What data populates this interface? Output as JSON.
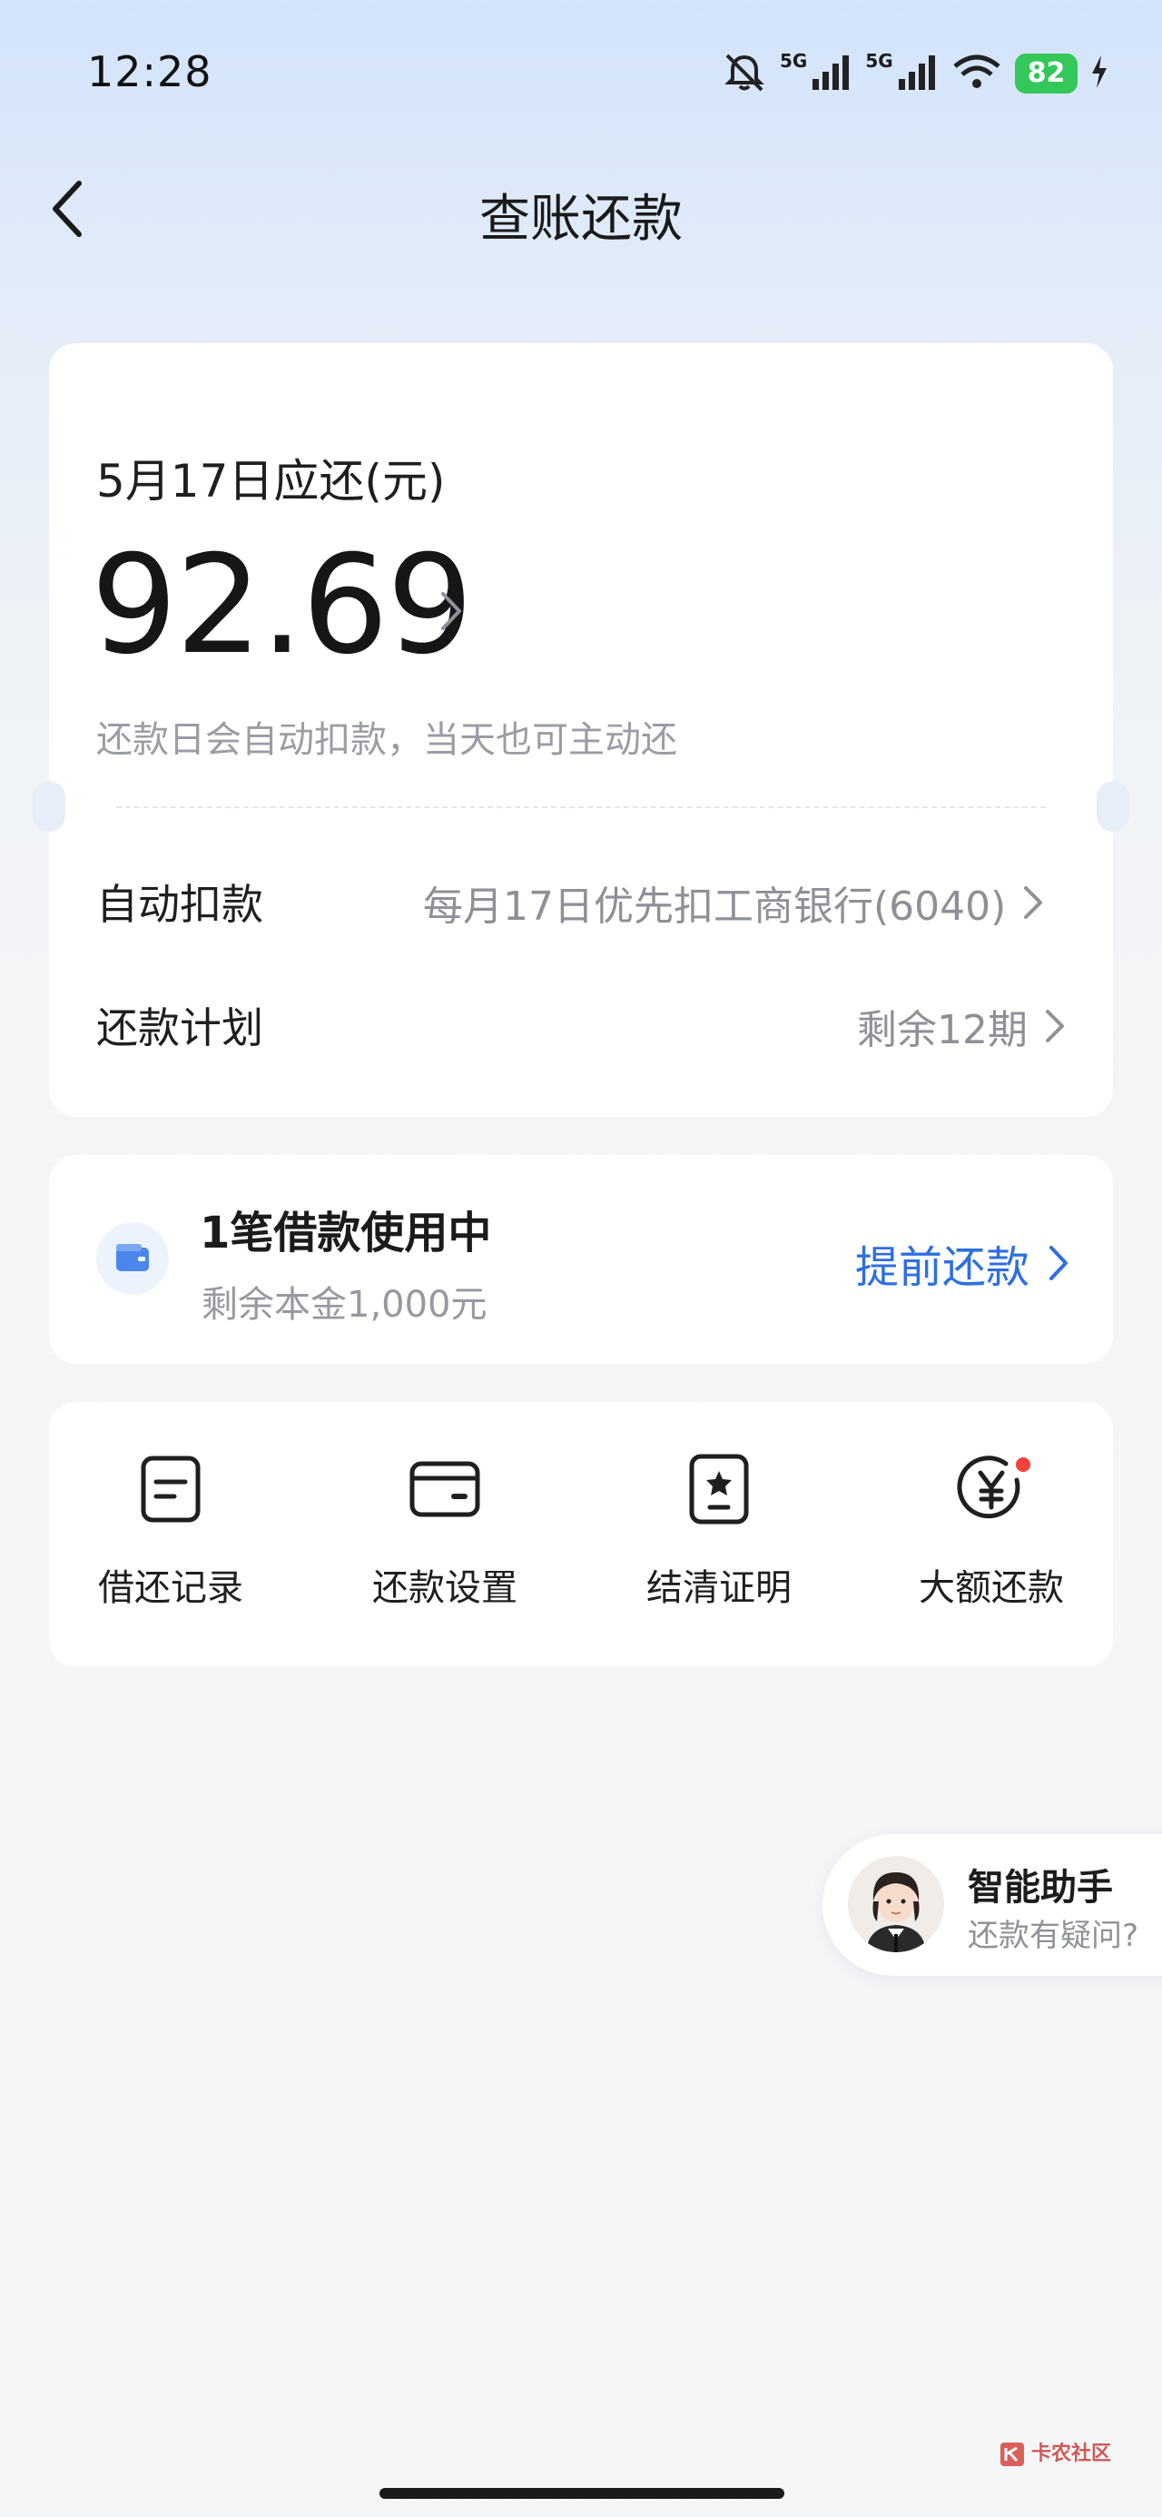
{
  "status_bar": {
    "time": "12:28",
    "network_1": "5G",
    "network_2": "5G",
    "battery": "82",
    "icons": [
      "mute-icon",
      "signal-icon",
      "signal-icon",
      "wifi-icon",
      "battery-icon",
      "charging-icon"
    ]
  },
  "header": {
    "title": "查账还款",
    "back_icon": "back-arrow-icon"
  },
  "bill": {
    "due_label": "5月17日应还(元)",
    "amount": "92.69",
    "note": "还款日会自动扣款，当天也可主动还",
    "auto_debit_label": "自动扣款",
    "auto_debit_value": "每月17日优先扣工商银行(6040)",
    "plan_label": "还款计划",
    "plan_value": "剩余12期"
  },
  "loan": {
    "title": "1笔借款使用中",
    "subtitle": "剩余本金1,000元",
    "action": "提前还款",
    "icon": "wallet-icon"
  },
  "tools": [
    {
      "label": "借还记录",
      "icon": "record-icon"
    },
    {
      "label": "还款设置",
      "icon": "card-settings-icon"
    },
    {
      "label": "结清证明",
      "icon": "certificate-icon"
    },
    {
      "label": "大额还款",
      "icon": "yuan-icon"
    }
  ],
  "assistant": {
    "title": "智能助手",
    "subtitle": "还款有疑问?"
  },
  "watermark": {
    "text": "卡农社区"
  },
  "colors": {
    "accent": "#2f6fe0",
    "battery": "#34c759",
    "badge": "#f0413b"
  }
}
